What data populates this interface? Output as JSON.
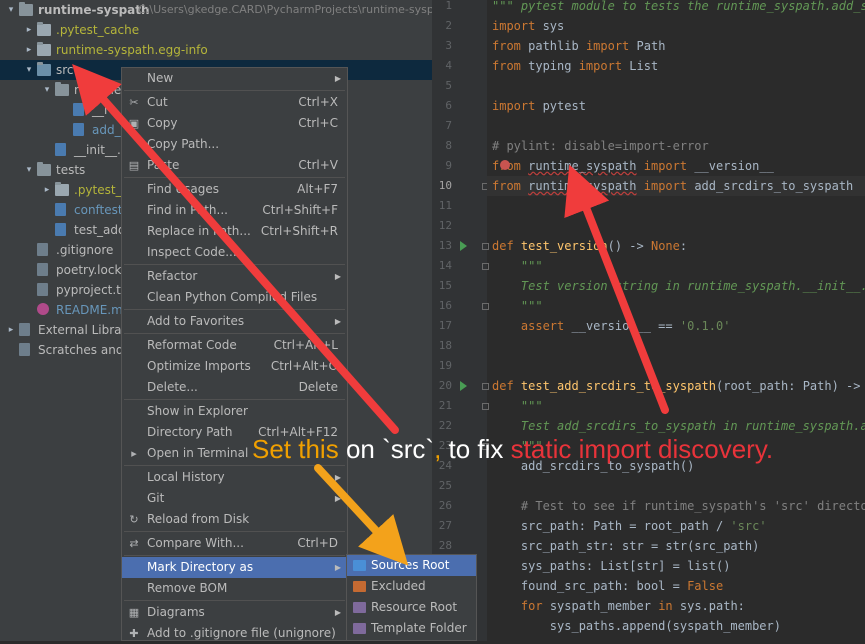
{
  "tree": {
    "items": [
      {
        "arrow": "▾",
        "icon": "folder",
        "label": "runtime-syspath",
        "path": "C:\\Users\\gkedge.CARD\\PycharmProjects\\runtime-syspa",
        "indent": 0,
        "style": "bold"
      },
      {
        "arrow": "▸",
        "icon": "folder",
        "label": ".pytest_cache",
        "indent": 1,
        "style": "yellow"
      },
      {
        "arrow": "▸",
        "icon": "folder",
        "label": "runtime-syspath.egg-info",
        "indent": 1,
        "style": "yellow"
      },
      {
        "arrow": "▾",
        "icon": "folder",
        "label": "src",
        "indent": 1,
        "style": "plain",
        "selected": true
      },
      {
        "arrow": "▾",
        "icon": "folder",
        "label": "runtime_s",
        "indent": 2,
        "style": "plain"
      },
      {
        "arrow": "",
        "icon": "file-py",
        "label": "__i",
        "indent": 3,
        "style": "plain"
      },
      {
        "arrow": "",
        "icon": "file-py",
        "label": "add_s",
        "indent": 3,
        "style": "blue"
      },
      {
        "arrow": "",
        "icon": "file-py",
        "label": "__init__.py",
        "indent": 2,
        "style": "plain"
      },
      {
        "arrow": "▾",
        "icon": "folder",
        "label": "tests",
        "indent": 1,
        "style": "plain"
      },
      {
        "arrow": "▸",
        "icon": "folder",
        "label": ".pytest_cac",
        "indent": 2,
        "style": "yellow"
      },
      {
        "arrow": "",
        "icon": "file-py",
        "label": "conftest.p",
        "indent": 2,
        "style": "blue"
      },
      {
        "arrow": "",
        "icon": "file-py",
        "label": "test_add_",
        "indent": 2,
        "style": "plain"
      },
      {
        "arrow": "",
        "icon": "file",
        "label": ".gitignore",
        "indent": 1,
        "style": "plain"
      },
      {
        "arrow": "",
        "icon": "file",
        "label": "poetry.lock",
        "indent": 1,
        "style": "plain"
      },
      {
        "arrow": "",
        "icon": "file",
        "label": "pyproject.tor",
        "indent": 1,
        "style": "plain"
      },
      {
        "arrow": "",
        "icon": "file-md",
        "label": "README.md",
        "indent": 1,
        "style": "blue"
      },
      {
        "arrow": "▸",
        "icon": "library",
        "label": "External Libraries",
        "indent": 0,
        "style": "plain"
      },
      {
        "arrow": "",
        "icon": "scratch",
        "label": "Scratches and C",
        "indent": 0,
        "style": "plain"
      }
    ]
  },
  "editor": {
    "line_numbers": [
      "1",
      "2",
      "3",
      "4",
      "5",
      "6",
      "7",
      "8",
      "9",
      "10",
      "11",
      "12",
      "13",
      "14",
      "15",
      "16",
      "17",
      "18",
      "19",
      "20",
      "21",
      "22",
      "23",
      "24",
      "25",
      "26",
      "27",
      "28",
      "29",
      "30",
      "31",
      "32"
    ],
    "current_line": "10",
    "lines": [
      "\"\"\" pytest module to tests the runtime_syspath.add_sr",
      "import sys",
      "from pathlib import Path",
      "from typing import List",
      "",
      "import pytest",
      "",
      "# pylint: disable=import-error",
      "from runtime_syspath import __version__",
      "from runtime_syspath import add_srcdirs_to_syspath",
      "",
      "",
      "def test_version() -> None:",
      "    \"\"\"",
      "    Test version string in runtime_syspath.__init__.py",
      "    \"\"\"",
      "    assert __version__ == '0.1.0'",
      "",
      "",
      "def test_add_srcdirs_to_syspath(root_path: Path) -> No",
      "    \"\"\"",
      "    Test add_srcdirs_to_syspath in runtime_syspath.add",
      "    \"\"\"",
      "    add_srcdirs_to_syspath()",
      "",
      "    # Test to see if runtime_syspath's 'src' directory",
      "    src_path: Path = root_path / 'src'",
      "    src_path_str: str = str(src_path)",
      "    sys_paths: List[str] = list()",
      "    found_src_path: bool = False",
      "    for syspath_member in sys.path:",
      "        sys_paths.append(syspath_member)"
    ]
  },
  "context_menu": {
    "items": [
      {
        "type": "item",
        "label": "New",
        "shortcut": "",
        "submenu": true,
        "icon": ""
      },
      {
        "type": "sep"
      },
      {
        "type": "item",
        "label": "Cut",
        "shortcut": "Ctrl+X",
        "icon": "scissors-icon",
        "glyph": "✂"
      },
      {
        "type": "item",
        "label": "Copy",
        "shortcut": "Ctrl+C",
        "icon": "copy-icon",
        "glyph": "▣"
      },
      {
        "type": "item",
        "label": "Copy Path...",
        "shortcut": "",
        "icon": ""
      },
      {
        "type": "item",
        "label": "Paste",
        "shortcut": "Ctrl+V",
        "icon": "paste-icon",
        "glyph": "▤"
      },
      {
        "type": "sep"
      },
      {
        "type": "item",
        "label": "Find Usages",
        "shortcut": "Alt+F7",
        "icon": ""
      },
      {
        "type": "item",
        "label": "Find in Path...",
        "shortcut": "Ctrl+Shift+F",
        "icon": ""
      },
      {
        "type": "item",
        "label": "Replace in Path...",
        "shortcut": "Ctrl+Shift+R",
        "icon": ""
      },
      {
        "type": "item",
        "label": "Inspect Code...",
        "shortcut": "",
        "icon": ""
      },
      {
        "type": "sep"
      },
      {
        "type": "item",
        "label": "Refactor",
        "shortcut": "",
        "submenu": true,
        "icon": ""
      },
      {
        "type": "item",
        "label": "Clean Python Compiled Files",
        "shortcut": "",
        "icon": ""
      },
      {
        "type": "sep"
      },
      {
        "type": "item",
        "label": "Add to Favorites",
        "shortcut": "",
        "submenu": true,
        "icon": ""
      },
      {
        "type": "sep"
      },
      {
        "type": "item",
        "label": "Reformat Code",
        "shortcut": "Ctrl+Alt+L",
        "icon": ""
      },
      {
        "type": "item",
        "label": "Optimize Imports",
        "shortcut": "Ctrl+Alt+O",
        "icon": ""
      },
      {
        "type": "item",
        "label": "Delete...",
        "shortcut": "Delete",
        "icon": ""
      },
      {
        "type": "sep"
      },
      {
        "type": "item",
        "label": "Show in Explorer",
        "shortcut": "",
        "icon": ""
      },
      {
        "type": "item",
        "label": "Directory Path",
        "shortcut": "Ctrl+Alt+F12",
        "icon": ""
      },
      {
        "type": "item",
        "label": "Open in Terminal",
        "shortcut": "",
        "icon": "terminal-icon",
        "glyph": "▸"
      },
      {
        "type": "sep"
      },
      {
        "type": "item",
        "label": "Local History",
        "shortcut": "",
        "submenu": true,
        "icon": ""
      },
      {
        "type": "item",
        "label": "Git",
        "shortcut": "",
        "submenu": true,
        "icon": ""
      },
      {
        "type": "item",
        "label": "Reload from Disk",
        "shortcut": "",
        "icon": "reload-icon",
        "glyph": "↻"
      },
      {
        "type": "sep"
      },
      {
        "type": "item",
        "label": "Compare With...",
        "shortcut": "Ctrl+D",
        "icon": "compare-icon",
        "glyph": "⇄"
      },
      {
        "type": "sep"
      },
      {
        "type": "item",
        "label": "Mark Directory as",
        "shortcut": "",
        "submenu": true,
        "icon": "",
        "highlighted": true
      },
      {
        "type": "item",
        "label": "Remove BOM",
        "shortcut": "",
        "icon": ""
      },
      {
        "type": "sep"
      },
      {
        "type": "item",
        "label": "Diagrams",
        "shortcut": "",
        "submenu": true,
        "icon": "diagram-icon",
        "glyph": "▦"
      },
      {
        "type": "item",
        "label": "Add to .gitignore file (unignore)",
        "shortcut": "",
        "icon": "gitignore-icon",
        "glyph": "✚"
      }
    ]
  },
  "submenu": {
    "items": [
      {
        "label": "Sources Root",
        "color": "#4a8fd6",
        "highlighted": true,
        "icon": "sources-root-icon"
      },
      {
        "label": "Excluded",
        "color": "#c46a32",
        "icon": "excluded-icon"
      },
      {
        "label": "Resource Root",
        "color": "#7f6a9c",
        "icon": "resource-root-icon"
      },
      {
        "label": "Template Folder",
        "color": "#7f6a9c",
        "icon": "template-folder-icon"
      }
    ]
  },
  "annotation": {
    "part1": "Set this",
    "part2": " on `src`",
    "part3": ", ",
    "part4": "to fix ",
    "part5": "static import discovery.",
    "colors": {
      "orange": "#f0a000",
      "white": "#ffffff",
      "red": "#e8333a",
      "arrow_red": "#f03c3c",
      "arrow_orange": "#f3a21b"
    }
  }
}
